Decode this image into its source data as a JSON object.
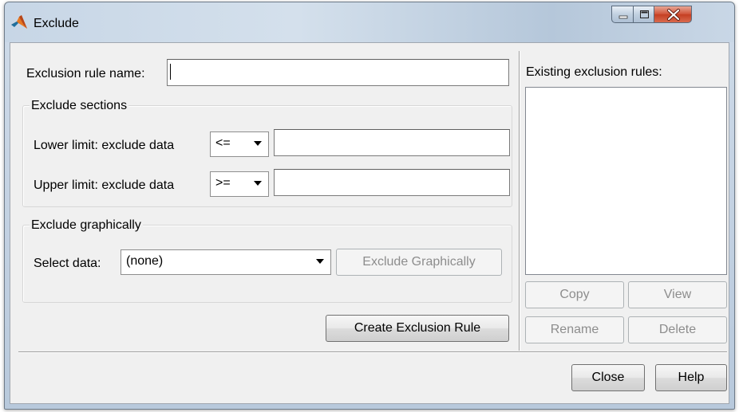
{
  "window": {
    "title": "Exclude",
    "minimize_icon": "minimize-icon",
    "maximize_icon": "maximize-icon",
    "close_icon": "close-x-icon",
    "app_icon": "matlab-logo-icon"
  },
  "rule_name": {
    "label": "Exclusion rule name:",
    "value": ""
  },
  "exclude_sections": {
    "title": "Exclude sections",
    "lower": {
      "label": "Lower limit: exclude data",
      "operator": "<=",
      "value": ""
    },
    "upper": {
      "label": "Upper limit: exclude data",
      "operator": ">=",
      "value": ""
    }
  },
  "exclude_graphically": {
    "title": "Exclude graphically",
    "select_label": "Select data:",
    "select_value": "(none)",
    "button_label": "Exclude Graphically",
    "button_enabled": false
  },
  "create_button": "Create Exclusion Rule",
  "existing": {
    "label": "Existing exclusion rules:",
    "items": [],
    "buttons": {
      "copy": "Copy",
      "view": "View",
      "rename": "Rename",
      "delete": "Delete"
    }
  },
  "footer": {
    "close": "Close",
    "help": "Help"
  },
  "colors": {
    "titlebar": "#c7d6e6",
    "client_bg": "#f0f0f0",
    "close_button": "#c43f22",
    "disabled_text": "#8d8d8d"
  }
}
